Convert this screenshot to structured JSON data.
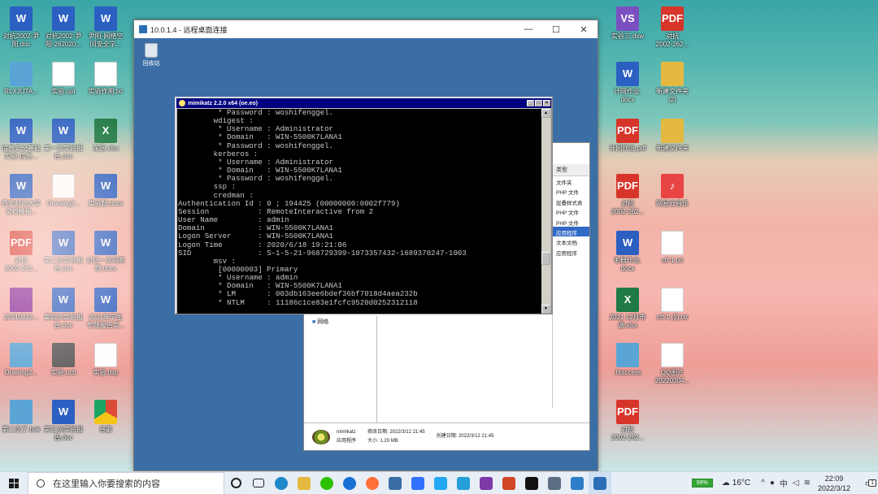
{
  "desktop_left": [
    {
      "label": "对抗2002-尹\n阳.doc",
      "type": "word"
    },
    {
      "label": "对抗2002-尹\n阳-262020...",
      "type": "word"
    },
    {
      "label": "尹阳-网络空\n间安全学...",
      "type": "word"
    },
    {
      "label": "RLXJUTA...",
      "type": "img"
    },
    {
      "label": "实验.opt",
      "type": "txt"
    },
    {
      "label": "实验作用.txt",
      "type": "txt"
    },
    {
      "label": "信息安全基础\n实验-信息...",
      "type": "word"
    },
    {
      "label": "第一次实验报\n告.doc",
      "type": "word"
    },
    {
      "label": "东区.xlsx",
      "type": "excel"
    },
    {
      "label": "西安邮电大学\n文档模板...",
      "type": "word"
    },
    {
      "label": "Drawing2...",
      "type": "txt"
    },
    {
      "label": "实验题.docx",
      "type": "word"
    },
    {
      "label": "对抗\n2002-262...",
      "type": "pdf"
    },
    {
      "label": "第二次实验报\n告.doc",
      "type": "word"
    },
    {
      "label": "对抗一次问答\n题.docx",
      "type": "word"
    },
    {
      "label": "20210813...",
      "type": "rar"
    },
    {
      "label": "第四次实验报\n告.doc",
      "type": "word"
    },
    {
      "label": "2021年学生\n专题报告实...",
      "type": "word"
    },
    {
      "label": "Drawing2...",
      "type": "img"
    },
    {
      "label": "实验.ucb",
      "type": "exe"
    },
    {
      "label": "实验.dsp",
      "type": "txt"
    },
    {
      "label": "第二次了.bak",
      "type": "img"
    },
    {
      "label": "第三次实验报\n告.doc",
      "type": "word"
    },
    {
      "label": "谷歌",
      "type": "chrome"
    }
  ],
  "desktop_right": [
    {
      "label": "实验三.dsw",
      "type": "vs"
    },
    {
      "label": "对抗\n2002-262...",
      "type": "pdf"
    },
    {
      "label": "计网作业.\ndocx",
      "type": "word"
    },
    {
      "label": "新建文件夹\n(2)",
      "type": "folder"
    },
    {
      "label": "计网作业.pdf",
      "type": "pdf"
    },
    {
      "label": "新建文件夹",
      "type": "folder"
    },
    {
      "label": "对抗\n2002-262...",
      "type": "pdf"
    },
    {
      "label": "网易云音乐",
      "type": "app"
    },
    {
      "label": "毛概作业.\ndocx",
      "type": "word"
    },
    {
      "label": "ctf-1.txt",
      "type": "txt"
    },
    {
      "label": "2021 12月市\n调.xlsx",
      "type": "excel"
    },
    {
      "label": "ctf-1 (2).txt",
      "type": "txt"
    },
    {
      "label": ".htaccess",
      "type": "img"
    },
    {
      "label": "QQ图片\n20220304...",
      "type": "txt"
    },
    {
      "label": "对抗\n2002-262...",
      "type": "pdf"
    }
  ],
  "rdp": {
    "title": "10.0.1.4 - 远程桌面连接",
    "recycle_label": "回收站"
  },
  "console": {
    "title": "mimikatz 2.2.0 x64 (oe.eo)",
    "lines": [
      "         * Password : woshifenggel.",
      "        wdigest :",
      "         * Username : Administrator",
      "         * Domain   : WIN-5500K7LANA1",
      "         * Password : woshifenggel.",
      "        kerberos :",
      "         * Username : Administrator",
      "         * Domain   : WIN-5500K7LANA1",
      "         * Password : woshifenggel.",
      "        ssp :",
      "        credman :",
      "",
      "Authentication Id : 0 ; 194425 (00000000:0002f779)",
      "Session           : RemoteInteractive from 2",
      "User Name         : admin",
      "Domain            : WIN-5500K7LANA1",
      "Logon Server      : WIN-5500K7LANA1",
      "Logon Time        : 2020/6/18 19:21:06",
      "SID               : S-1-5-21-968729399-1073357432-1689370247-1003",
      "        msv :",
      "         [00000003] Primary",
      "         * Username : admin",
      "         * Domain   : WIN-5500K7LANA1",
      "         * LM       : 003db163ee6bdef36bf7018d4aea232b",
      "         * NTLM     : 11186c1ce83e1fcfc9520d0252312118"
    ]
  },
  "explorer": {
    "type_header": "类型",
    "types": [
      "文件夹",
      "PHP 文件",
      "层叠样式表",
      "PHP 文件",
      "PHP 文件",
      "应用程序",
      "文本文档",
      "应用程序"
    ],
    "selected_type_index": 5,
    "tree_item": "网络",
    "details": {
      "name": "mimikatz",
      "kind": "应用程序",
      "modified": "修改日期: 2022/3/12 21:45",
      "size": "大小: 1.20 MB",
      "created": "创建日期: 2022/3/12 21:45"
    }
  },
  "taskbar": {
    "search_placeholder": "在这里输入你要搜索的内容",
    "battery": "99%",
    "temperature": "16°C",
    "time": "22:09",
    "date": "2022/3/12",
    "notification_count": "1"
  }
}
